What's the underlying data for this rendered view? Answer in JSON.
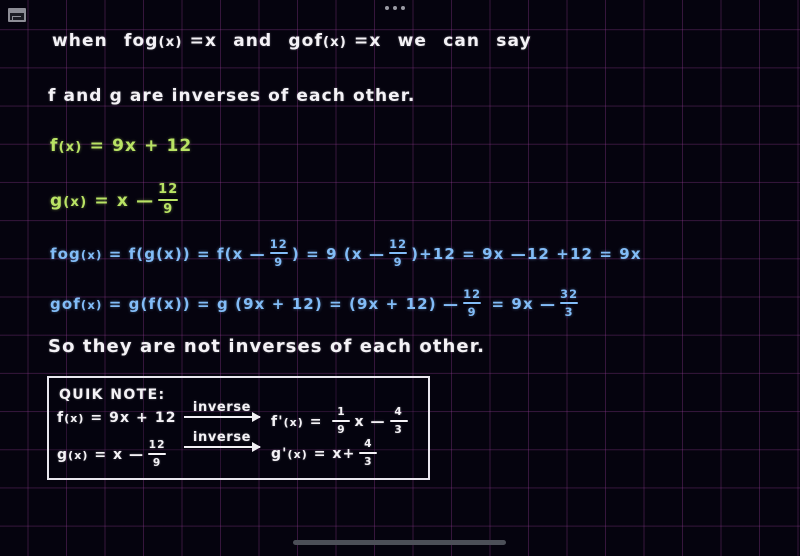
{
  "app": {
    "background_color": "#05030e",
    "grid_color": "#963c96",
    "window_icon": "window-panel-icon",
    "more_dots": "more-options-dots",
    "scroll_indicator": "bottom-scrollbar"
  },
  "palette": {
    "white_ink": "#f4f2f6",
    "green_ink": "#b9e364",
    "blue_ink": "#82bcf7"
  },
  "notes": {
    "line1": {
      "color": "white",
      "parts": [
        "when",
        "fog",
        "(x)",
        "=",
        "x",
        "and",
        "gof",
        "(x)",
        "=",
        "x",
        "we",
        "can",
        "say"
      ],
      "text": "when fog(x) = x and gof(x) = x we can say"
    },
    "line2": {
      "color": "white",
      "text": "f and g are inverses of each other."
    },
    "f_def": {
      "color": "green",
      "lhs": "f",
      "lhs_arg": "(x)",
      "eq": "=",
      "rhs": "9x + 12",
      "text": "f(x) = 9x + 12"
    },
    "g_def": {
      "color": "green",
      "lhs": "g",
      "lhs_arg": "(x)",
      "eq": "=",
      "rhs_lead": "x",
      "minus": "—",
      "frac_num": "12",
      "frac_den": "9",
      "text": "g(x) = x - 12/9"
    },
    "fog_line": {
      "color": "blue",
      "text": "fog(x) = f(g(x)) = f(x - 12/9) = 9(x - 12/9) + 12 = 9x - 12 + 12 = 9x",
      "tokens": {
        "t1": "fog",
        "t1a": "(x)",
        "eq1": "=",
        "t2": "f(g(x))",
        "eq2": "=",
        "t3_lead": "f(",
        "t3_x": "x",
        "t3_minus": "—",
        "t3_num": "12",
        "t3_den": "9",
        "t3_close": ")",
        "eq3": "=",
        "t4_lead": "9 (",
        "t4_x": "x",
        "t4_minus": "—",
        "t4_num": "12",
        "t4_den": "9",
        "t4_close": ")",
        "t4_tail": "+12",
        "eq4": "=",
        "t5": "9x —12 +12",
        "eq5": "=",
        "t6": "9x"
      }
    },
    "gof_line": {
      "color": "blue",
      "text": "gof(x) = g(f(x)) = g(9x + 12) = (9x + 12) - 12/9 = 9x - 32/3",
      "tokens": {
        "t1": "gof",
        "t1a": "(x)",
        "eq1": "=",
        "t2": "g(f(x))",
        "eq2": "=",
        "t3": "g (9x + 12)",
        "eq3": "=",
        "t4": "(9x + 12)",
        "t4_minus": "—",
        "t4_num": "12",
        "t4_den": "9",
        "eq4": "=",
        "t5": "9x",
        "t5_minus": "—",
        "t5_num": "32",
        "t5_den": "3"
      }
    },
    "conclusion": {
      "color": "white",
      "text": "So they are not inverses of each other."
    }
  },
  "quik_note": {
    "title": "QUIK NOTE:",
    "arrow_label_1": "inverse",
    "arrow_label_2": "inverse",
    "row1": {
      "left": "f(x) = 9x + 12",
      "left_fn": "f",
      "left_arg": "(x)",
      "left_eq": "=",
      "left_rhs": "9x + 12",
      "right_fn": "f'",
      "right_arg": "(x)",
      "right_eq": "=",
      "frac1_num": "1",
      "frac1_den": "9",
      "mid_x": "x",
      "minus": "—",
      "frac2_num": "4",
      "frac2_den": "3",
      "right_text": "f'(x) = (1/9)x - 4/3"
    },
    "row2": {
      "left_fn": "g",
      "left_arg": "(x)",
      "left_eq": "=",
      "left_x": "x",
      "left_minus": "—",
      "left_num": "12",
      "left_den": "9",
      "left_text": "g(x) = x - 12/9",
      "right_fn": "g'",
      "right_arg": "(x)",
      "right_eq": "=",
      "right_x": "x",
      "plus": "+",
      "frac_num": "4",
      "frac_den": "3",
      "right_text": "g'(x) = x + 4/3"
    }
  }
}
